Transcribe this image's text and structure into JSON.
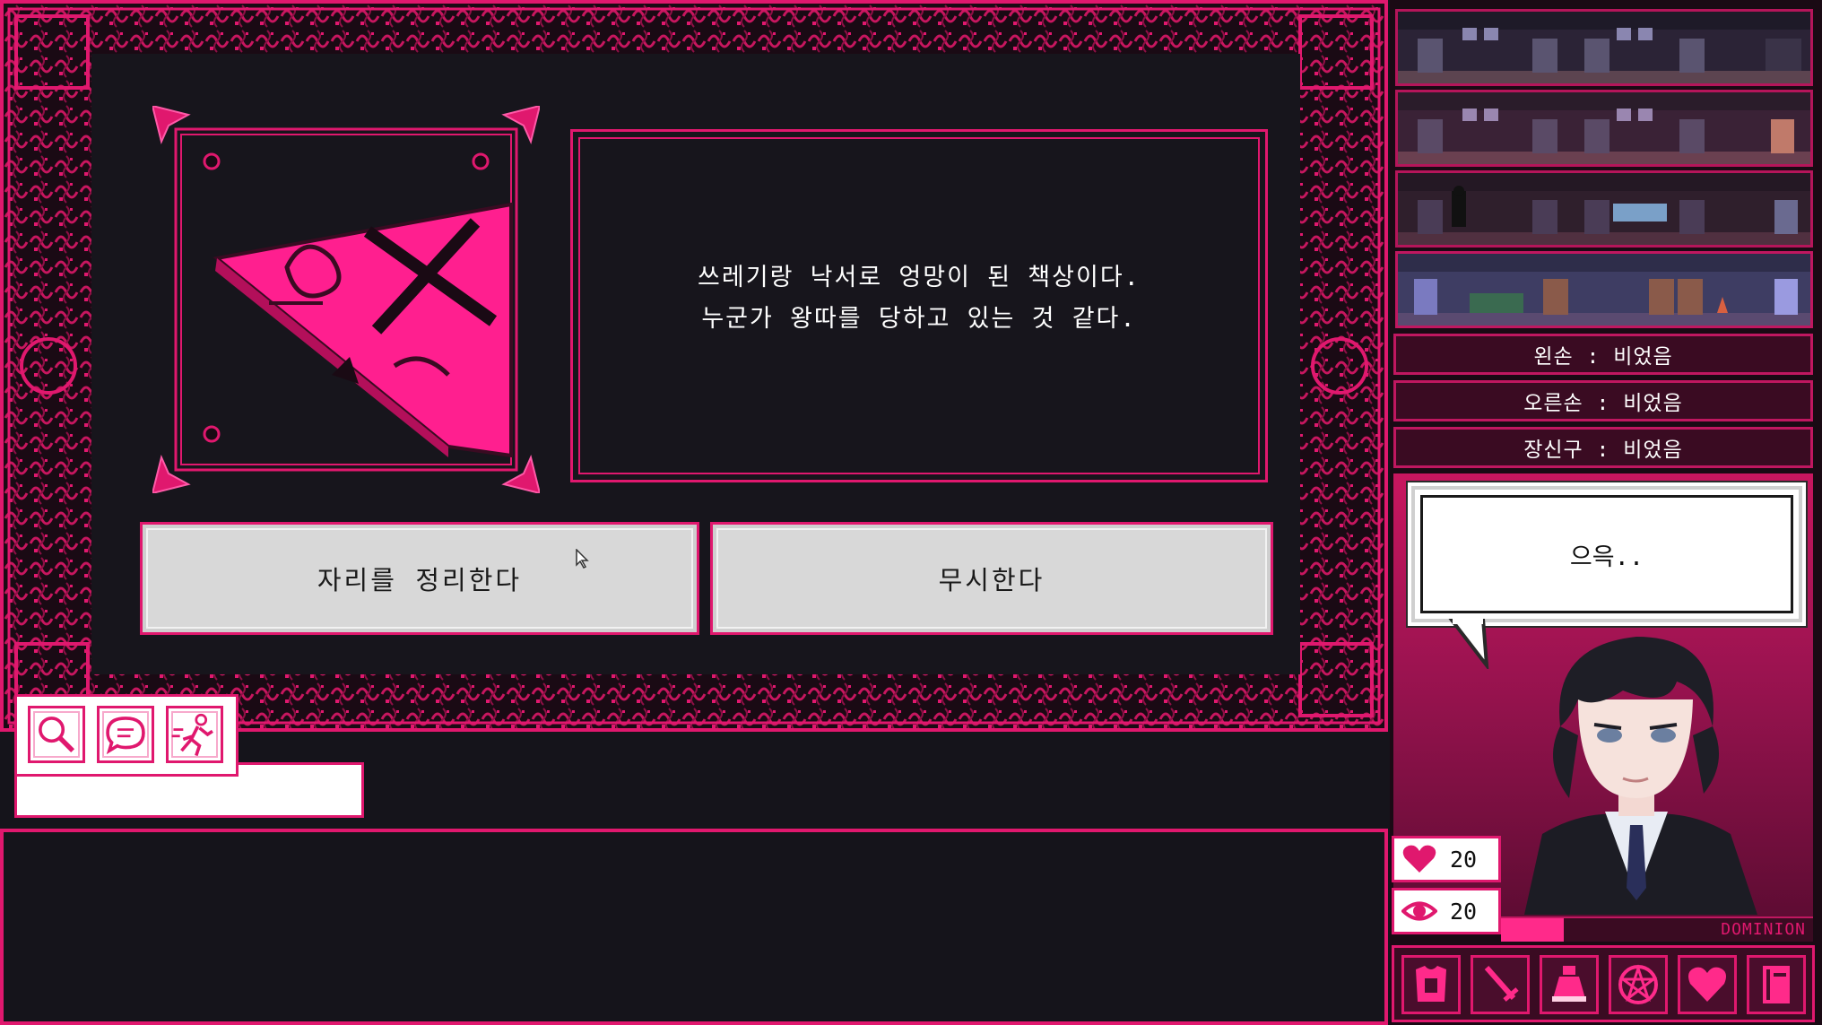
{
  "scene": {
    "description_lines": [
      "쓰레기랑 낙서로 엉망이 된 책상이다.",
      "누군가 왕따를 당하고 있는 것 같다."
    ],
    "choices": [
      {
        "label": "자리를 정리한다"
      },
      {
        "label": "무시한다"
      }
    ]
  },
  "action_bar": {
    "icons": [
      "magnifier-icon",
      "speech-icon",
      "running-person-icon"
    ]
  },
  "equipment": {
    "left_hand": "왼손 : 비었음",
    "right_hand": "오른손 : 비었음",
    "accessory": "장신구 : 비었음"
  },
  "character": {
    "speech": "으윽.."
  },
  "stats": {
    "hp": "20",
    "sanity": "20",
    "dominion_label": "DOMINION",
    "dominion_fraction": 0.2
  },
  "toolbar": {
    "icons": [
      "armor-icon",
      "sword-icon",
      "potion-bag-icon",
      "pentagram-icon",
      "heart-icon",
      "book-icon"
    ]
  },
  "colors": {
    "accent": "#e0186e",
    "background": "#15141b",
    "button": "#d8d8d8"
  }
}
